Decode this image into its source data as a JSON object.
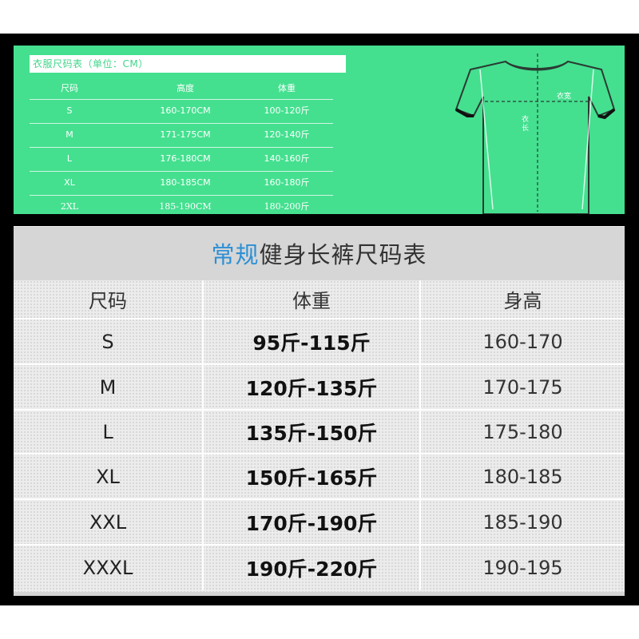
{
  "top_chart": {
    "title": "衣服尺码表（单位：CM）",
    "headers": [
      "尺码",
      "高度",
      "体重"
    ],
    "rows": [
      [
        "S",
        "160-170CM",
        "100-120斤"
      ],
      [
        "M",
        "171-175CM",
        "120-140斤"
      ],
      [
        "L",
        "176-180CM",
        "140-160斤"
      ],
      [
        "XL",
        "180-185CM",
        "160-180斤"
      ],
      [
        "2XL",
        "185-190CM",
        "180-200斤"
      ]
    ],
    "shirt_labels": {
      "width": "衣宽",
      "length": "衣长"
    },
    "colors": {
      "background": "#44e08f",
      "title_text": "#3fd68a"
    }
  },
  "main_chart": {
    "title_accent": "常规",
    "title_rest": "健身长裤尺码表",
    "headers": [
      "尺码",
      "体重",
      "身高"
    ],
    "rows": [
      [
        "S",
        "95斤-115斤",
        "160-170"
      ],
      [
        "M",
        "120斤-135斤",
        "170-175"
      ],
      [
        "L",
        "135斤-150斤",
        "175-180"
      ],
      [
        "XL",
        "150斤-165斤",
        "180-185"
      ],
      [
        "XXL",
        "170斤-190斤",
        "185-190"
      ],
      [
        "XXXL",
        "190斤-220斤",
        "190-195"
      ]
    ],
    "colors": {
      "accent": "#2d8fd5",
      "band": "#d6d6d6",
      "table": "#ececec"
    }
  }
}
